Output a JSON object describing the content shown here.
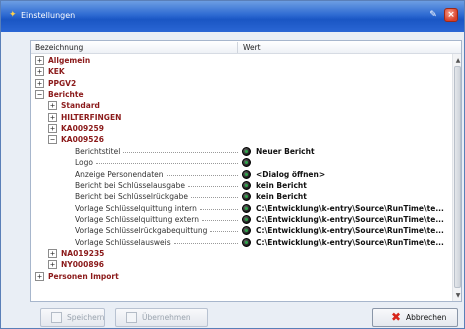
{
  "window": {
    "title": "Einstellungen"
  },
  "columns": {
    "name": "Bezeichnung",
    "value": "Wert"
  },
  "tree": [
    {
      "type": "node",
      "level": 0,
      "label": "Allgemein",
      "expander": "+"
    },
    {
      "type": "node",
      "level": 0,
      "label": "KEK",
      "expander": "+"
    },
    {
      "type": "node",
      "level": 0,
      "label": "PPGV2",
      "expander": "+"
    },
    {
      "type": "node",
      "level": 0,
      "label": "Berichte",
      "expander": "−"
    },
    {
      "type": "node",
      "level": 1,
      "label": "Standard",
      "expander": "+"
    },
    {
      "type": "node",
      "level": 1,
      "label": "HILTERFINGEN",
      "expander": "+"
    },
    {
      "type": "node",
      "level": 1,
      "label": "KA009259",
      "expander": "+"
    },
    {
      "type": "node",
      "level": 1,
      "label": "KA009526",
      "expander": "−"
    },
    {
      "type": "prop",
      "label": "Berichtstitel",
      "value": "Neuer Bericht"
    },
    {
      "type": "prop",
      "label": "Logo",
      "value": ""
    },
    {
      "type": "prop",
      "label": "Anzeige Personendaten",
      "value": "<Dialog öffnen>"
    },
    {
      "type": "prop",
      "label": "Bericht bei Schlüsselausgabe",
      "value": "kein Bericht"
    },
    {
      "type": "prop",
      "label": "Bericht bei Schlüsselrückgabe",
      "value": "kein Bericht"
    },
    {
      "type": "prop",
      "label": "Vorlage Schlüsselquittung intern",
      "value": "C:\\Entwicklung\\k-entry\\Source\\RunTime\\te..."
    },
    {
      "type": "prop",
      "label": "Vorlage Schlüsselquittung extern",
      "value": "C:\\Entwicklung\\k-entry\\Source\\RunTime\\te..."
    },
    {
      "type": "prop",
      "label": "Vorlage Schlüsselrückgabequittung",
      "value": "C:\\Entwicklung\\k-entry\\Source\\RunTime\\te..."
    },
    {
      "type": "prop",
      "label": "Vorlage Schlüsselausweis",
      "value": "C:\\Entwicklung\\k-entry\\Source\\RunTime\\te..."
    },
    {
      "type": "node",
      "level": 1,
      "label": "NA019235",
      "expander": "+"
    },
    {
      "type": "node",
      "level": 1,
      "label": "NY000896",
      "expander": "+"
    },
    {
      "type": "node",
      "level": 0,
      "label": "Personen Import",
      "expander": "+"
    }
  ],
  "buttons": {
    "save": "Speichern",
    "apply": "Übernehmen",
    "cancel": "Abbrechen"
  },
  "colors": {
    "node_label": "#8b1a1a",
    "titlebar": "#2e6ad2",
    "cancel_icon": "#d8261c"
  }
}
